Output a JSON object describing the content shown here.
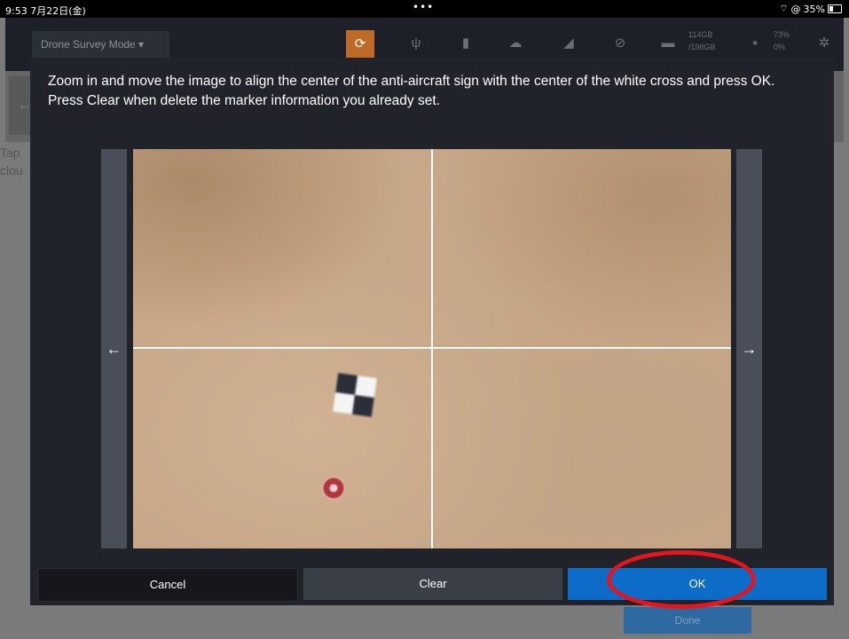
{
  "status_bar": {
    "time": "9:53",
    "date": "7月22日(金)",
    "battery_pct": "35%",
    "battery_icon": "battery-icon",
    "wifi_icon": "wifi-icon"
  },
  "app": {
    "mode_selector": "Drone Survey Mode ▾",
    "storage": {
      "used": "114GB",
      "total": "/198GB"
    },
    "battery": {
      "level": "73%",
      "other": "0%"
    },
    "background_text": [
      "Tap",
      "clou"
    ],
    "done_label": "Done"
  },
  "dialog": {
    "instruction_line1": "Zoom in and move the image to align the center of the anti-aircraft sign with the center of the white cross and press OK.",
    "instruction_line2": "Press Clear when delete the marker information you already set.",
    "prev_arrow": "←",
    "next_arrow": "→",
    "cancel_label": "Cancel",
    "clear_label": "Clear",
    "ok_label": "OK"
  },
  "colors": {
    "ok_button": "#0c6cc8",
    "highlight_ring": "#e6141c",
    "dialog_bg": "#202329"
  }
}
